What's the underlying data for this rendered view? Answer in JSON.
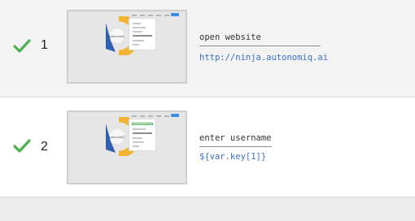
{
  "steps": [
    {
      "status_icon": "checkmark-icon",
      "number": "1",
      "action": "open website",
      "value": "http://ninja.autonomiq.ai",
      "thumbnail": {
        "brand": "AutonomIQ"
      }
    },
    {
      "status_icon": "checkmark-icon",
      "number": "2",
      "action": "enter username",
      "value": "${var.key[1]}",
      "thumbnail": {
        "brand": "AutonomIQ"
      }
    }
  ],
  "colors": {
    "success": "#4caf50",
    "value_text": "#3a6ec8",
    "logo_blue": "#2f5fb3",
    "logo_yellow": "#f2b533",
    "nav_button": "#3b8ee8"
  }
}
